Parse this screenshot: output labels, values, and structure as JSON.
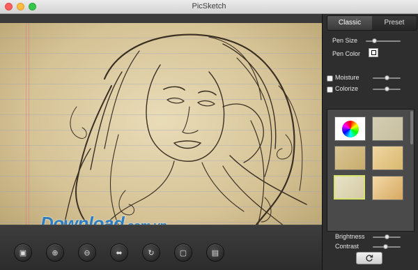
{
  "window": {
    "title": "PicSketch"
  },
  "canvas": {
    "watermark": "Download",
    "watermark_suffix": ".com.vn",
    "color_dots": [
      "#2f73b8",
      "#9b9b9b",
      "#5fa24b",
      "#e0a12f",
      "#2e89c6",
      "#cf2b2b"
    ]
  },
  "toolbar": {
    "tools": [
      {
        "name": "open-image-button",
        "icon": "image-icon"
      },
      {
        "name": "zoom-in-button",
        "icon": "zoom-in-icon"
      },
      {
        "name": "zoom-out-button",
        "icon": "zoom-out-icon"
      },
      {
        "name": "fit-button",
        "icon": "fit-icon"
      },
      {
        "name": "rotate-button",
        "icon": "rotate-icon"
      },
      {
        "name": "fullscreen-button",
        "icon": "frame-icon"
      },
      {
        "name": "save-button",
        "icon": "save-icon"
      }
    ]
  },
  "panel": {
    "tabs": {
      "classic": "Classic",
      "preset": "Preset"
    },
    "pen_size": {
      "label": "Pen Size",
      "value": 0.25
    },
    "pen_color": {
      "label": "Pen Color",
      "color": "#000000"
    },
    "moisture": {
      "label": "Moisture",
      "checked": false,
      "value": 0.5
    },
    "colorize": {
      "label": "Colorize",
      "checked": false,
      "value": 0.5
    },
    "brightness": {
      "label": "Brightness",
      "value": 0.5
    },
    "contrast": {
      "label": "Contrast",
      "value": 0.45
    },
    "refresh_icon": "refresh-icon"
  }
}
